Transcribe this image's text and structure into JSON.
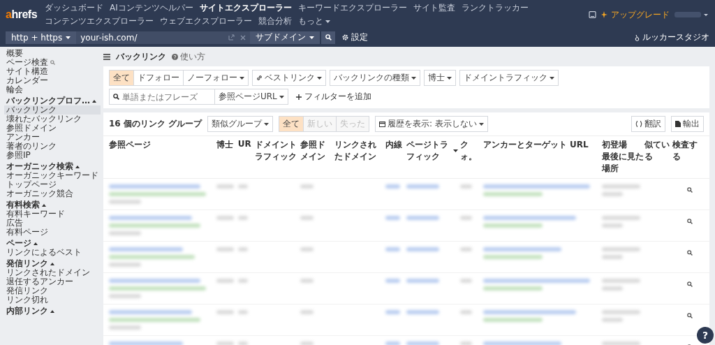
{
  "logo": {
    "accent": "a",
    "rest": "hrefs"
  },
  "nav": [
    {
      "label": "ダッシュボード",
      "selected": false,
      "dropdown": false
    },
    {
      "label": "AIコンテンツヘルパー",
      "selected": false,
      "dropdown": false
    },
    {
      "label": "サイトエクスプローラー",
      "selected": true,
      "dropdown": false
    },
    {
      "label": "キーワードエクスプローラー",
      "selected": false,
      "dropdown": false
    },
    {
      "label": "サイト監査",
      "selected": false,
      "dropdown": false
    },
    {
      "label": "ランクトラッカー",
      "selected": false,
      "dropdown": false
    },
    {
      "label": "コンテンツエクスプローラー",
      "selected": false,
      "dropdown": false
    },
    {
      "label": "ウェブエクスプローラー",
      "selected": false,
      "dropdown": false
    },
    {
      "label": "競合分析",
      "selected": false,
      "dropdown": false
    },
    {
      "label": "もっと",
      "selected": false,
      "dropdown": true
    }
  ],
  "upgrade": "アップグレード",
  "searchbar": {
    "protocol": "http + https",
    "url": "your-ish.com/",
    "mode": "サブドメイン",
    "settings": "設定",
    "looker": "ルッカースタジオ"
  },
  "sidebar": {
    "top": [
      {
        "label": "概要",
        "kind": "plain"
      },
      {
        "label": "ページ検査",
        "kind": "search"
      },
      {
        "label": "サイト構造",
        "kind": "plain"
      },
      {
        "label": "カレンダー",
        "kind": "plain"
      },
      {
        "label": "輪会",
        "kind": "plain"
      }
    ],
    "groups": [
      {
        "title": "バックリンクプロフ…",
        "expanded": true,
        "items": [
          {
            "label": "バックリンク",
            "selected": true
          },
          {
            "label": "壊れたバックリンク",
            "selected": false
          },
          {
            "label": "参照ドメイン",
            "selected": false
          },
          {
            "label": "アンカー",
            "selected": false
          },
          {
            "label": "著者のリンク",
            "selected": false
          },
          {
            "label": "参照IP",
            "selected": false
          }
        ]
      },
      {
        "title": "オーガニック検索",
        "expanded": true,
        "items": [
          {
            "label": "オーガニックキーワード",
            "selected": false
          },
          {
            "label": "トップページ",
            "selected": false
          },
          {
            "label": "オーガニック競合",
            "selected": false
          }
        ]
      },
      {
        "title": "有料検索",
        "expanded": true,
        "items": [
          {
            "label": "有料キーワード",
            "selected": false
          },
          {
            "label": "広告",
            "selected": false
          },
          {
            "label": "有料ページ",
            "selected": false
          }
        ]
      },
      {
        "title": "ページ",
        "expanded": true,
        "items": [
          {
            "label": "リンクによるベスト",
            "selected": false
          }
        ]
      },
      {
        "title": "発信リンク",
        "expanded": true,
        "items": [
          {
            "label": "リンクされたドメイン",
            "selected": false
          },
          {
            "label": "退任するアンカー",
            "selected": false
          },
          {
            "label": "発信リンク",
            "selected": false
          },
          {
            "label": "リンク切れ",
            "selected": false
          }
        ]
      },
      {
        "title": "内部リンク",
        "expanded": true
      }
    ]
  },
  "page": {
    "title": "バックリンク",
    "help": "使い方"
  },
  "filters": [
    {
      "kind": "segment",
      "options": [
        {
          "label": "全て",
          "selected": true,
          "dropdown": false
        },
        {
          "label": "ドフォロー",
          "selected": false,
          "dropdown": false
        },
        {
          "label": "ノーフォロー",
          "selected": false,
          "dropdown": true
        }
      ]
    },
    {
      "kind": "link-dropdown",
      "label": "ベストリンク"
    },
    {
      "kind": "dropdown",
      "label": "バックリンクの種類"
    },
    {
      "kind": "dropdown",
      "label": "博士"
    },
    {
      "kind": "dropdown",
      "label": "ドメイントラフィック"
    },
    {
      "kind": "search",
      "placeholder": "単語またはフレーズ",
      "scope": "参照ページURL"
    },
    {
      "kind": "add",
      "label": "フィルターを追加"
    }
  ],
  "toolbar": {
    "count": "16 個のリンク グループ",
    "grouping": "類似グループ",
    "segments": [
      {
        "label": "全て",
        "selected": true,
        "disabled": false
      },
      {
        "label": "新しい",
        "selected": false,
        "disabled": true
      },
      {
        "label": "失った",
        "selected": false,
        "disabled": true
      }
    ],
    "history": "履歴を表示: 表示しない",
    "translate": "翻訳",
    "export": "輸出"
  },
  "table": {
    "columns": [
      {
        "label": "参照ページ"
      },
      {
        "label": "博士"
      },
      {
        "label": "UR"
      },
      {
        "label": "ドメイントラフィック"
      },
      {
        "label": "参照ドメイン"
      },
      {
        "label": "リンクされたドメイン"
      },
      {
        "label": "内線"
      },
      {
        "label": "ページトラフィック",
        "sorted": true
      },
      {
        "label": "クォ。"
      },
      {
        "label": "アンカーとターゲット URL"
      },
      {
        "label": "初登場",
        "sublabel": "最後に見た場所"
      },
      {
        "label": "似ている"
      },
      {
        "label": "検査する"
      }
    ],
    "rows": [
      {
        "kind": "redacted"
      },
      {
        "kind": "redacted"
      },
      {
        "kind": "redacted"
      },
      {
        "kind": "redacted"
      },
      {
        "kind": "redacted"
      },
      {
        "kind": "redacted"
      }
    ]
  },
  "help_button": "?"
}
